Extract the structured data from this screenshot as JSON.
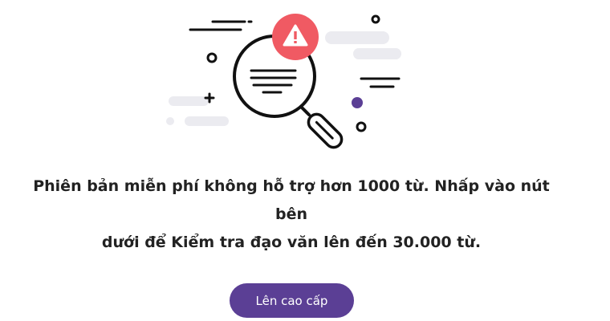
{
  "message": {
    "line1": "Phiên bản miễn phí không hỗ trợ hơn 1000 từ. Nhấp vào nút bên",
    "line2": "dưới để Kiểm tra đạo văn lên đến 30.000 từ."
  },
  "upgrade_button": {
    "label": "Lên cao cấp"
  },
  "illustration": {
    "icon": "magnifier-warning-icon",
    "colors": {
      "alert": "#f05a63",
      "accent": "#5b3f95",
      "cloud": "#ebebf0"
    }
  }
}
